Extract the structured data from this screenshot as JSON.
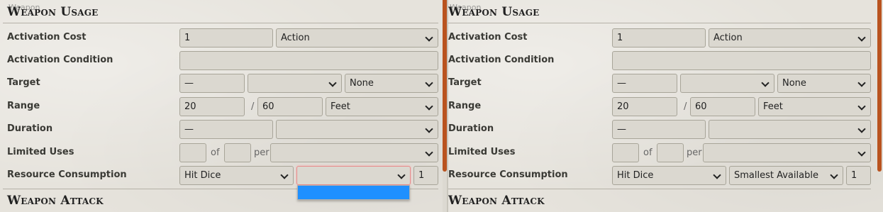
{
  "left": {
    "ghost_title": "Weapon",
    "section_title": "Weapon Usage",
    "attack_title": "Weapon Attack",
    "rows": {
      "activation_cost": {
        "label": "Activation Cost",
        "value": "1",
        "type": "Action"
      },
      "activation_condition": {
        "label": "Activation Condition",
        "value": ""
      },
      "target": {
        "label": "Target",
        "value": "—",
        "units": "",
        "type": "None"
      },
      "range": {
        "label": "Range",
        "value": "20",
        "sep": "/",
        "long": "60",
        "units": "Feet"
      },
      "duration": {
        "label": "Duration",
        "value": "—",
        "units": ""
      },
      "limited_uses": {
        "label": "Limited Uses",
        "value": "",
        "of": "of",
        "max": "",
        "per": "per",
        "period": ""
      },
      "resource": {
        "label": "Resource Consumption",
        "type": "Hit Dice",
        "target": "",
        "amount": "1"
      }
    },
    "dropdown": {
      "open": true,
      "highlighted_option": ""
    }
  },
  "right": {
    "ghost_title": "Weapon",
    "section_title": "Weapon Usage",
    "attack_title": "Weapon Attack",
    "rows": {
      "activation_cost": {
        "label": "Activation Cost",
        "value": "1",
        "type": "Action"
      },
      "activation_condition": {
        "label": "Activation Condition",
        "value": ""
      },
      "target": {
        "label": "Target",
        "value": "—",
        "units": "",
        "type": "None"
      },
      "range": {
        "label": "Range",
        "value": "20",
        "sep": "/",
        "long": "60",
        "units": "Feet"
      },
      "duration": {
        "label": "Duration",
        "value": "—",
        "units": ""
      },
      "limited_uses": {
        "label": "Limited Uses",
        "value": "",
        "of": "of",
        "max": "",
        "per": "per",
        "period": ""
      },
      "resource": {
        "label": "Resource Consumption",
        "type": "Hit Dice",
        "target": "Smallest Available",
        "amount": "1"
      }
    }
  },
  "colors": {
    "accent": "#b9531f",
    "highlight": "#1f90ff",
    "focus_border": "#e88a8a"
  }
}
